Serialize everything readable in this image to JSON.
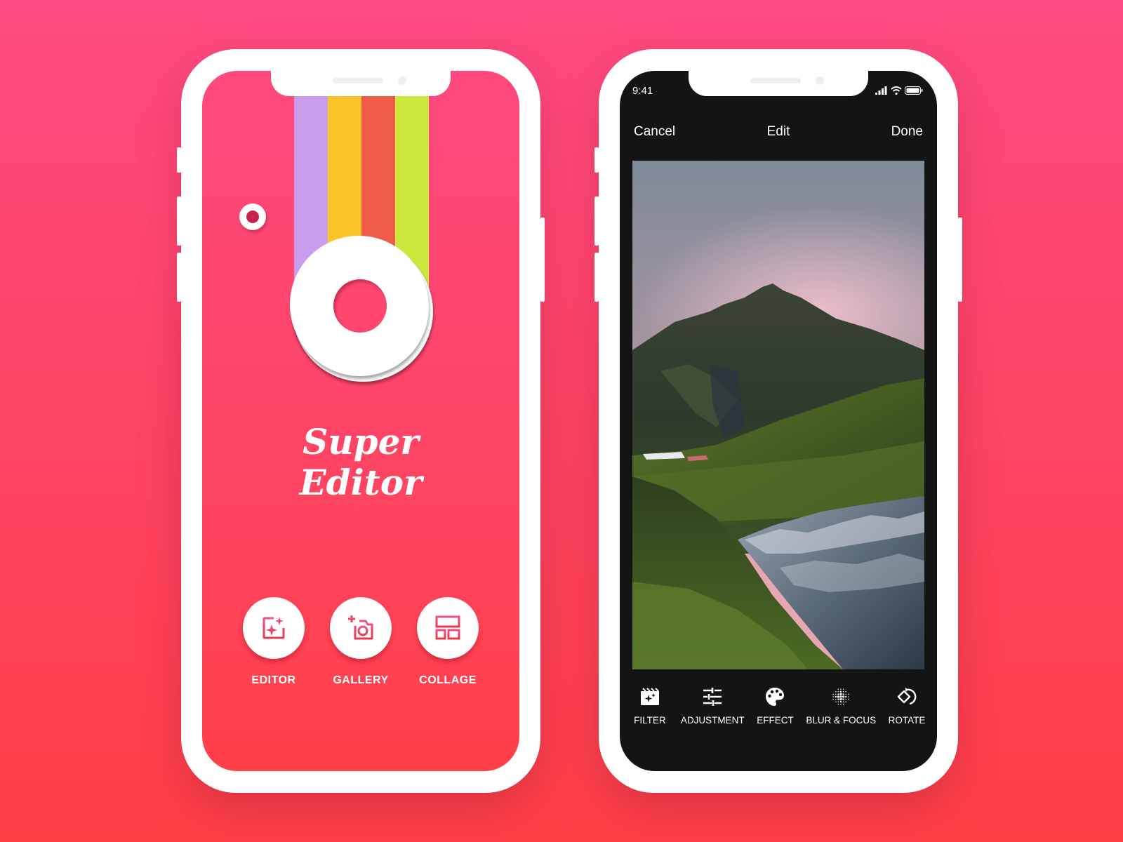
{
  "background": {
    "top_color": "#ff4a82",
    "bottom_color": "#ff4046"
  },
  "home_screen": {
    "app_name_line1": "Super",
    "app_name_line2": "Editor",
    "stripe_colors": [
      "#c99cec",
      "#fbc52a",
      "#f05b4a",
      "#cde83d"
    ],
    "actions": [
      {
        "label": "EDITOR",
        "icon": "photo-sparkle-icon"
      },
      {
        "label": "GALLERY",
        "icon": "add-camera-icon"
      },
      {
        "label": "COLLAGE",
        "icon": "collage-layout-icon"
      }
    ],
    "accent_color": "#e83f6a"
  },
  "edit_screen": {
    "status_bar": {
      "time": "9:41",
      "icons": [
        "signal-icon",
        "wifi-icon",
        "battery-icon"
      ]
    },
    "nav": {
      "cancel_label": "Cancel",
      "title": "Edit",
      "done_label": "Done"
    },
    "photo": {
      "description": "mountain landscape with waterfall"
    },
    "tools": [
      {
        "label": "FILTER",
        "icon": "filter-clapper-icon"
      },
      {
        "label": "ADJUSTMENT",
        "icon": "sliders-icon"
      },
      {
        "label": "EFFECT",
        "icon": "palette-icon"
      },
      {
        "label": "BLUR & FOCUS",
        "icon": "blur-dots-icon"
      },
      {
        "label": "ROTATE",
        "icon": "rotate-icon"
      }
    ]
  }
}
